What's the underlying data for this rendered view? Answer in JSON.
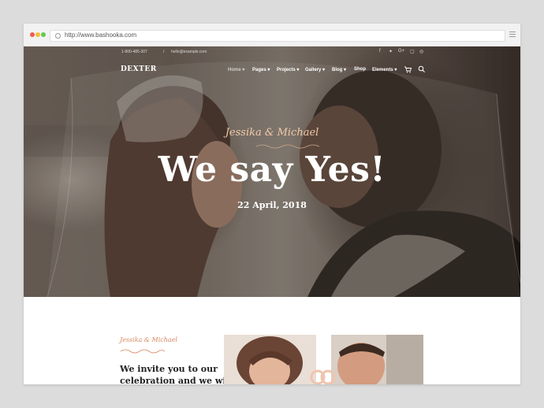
{
  "browser": {
    "url": "http://www.bashooka.com"
  },
  "topbar": {
    "phone": "1-800-485-307",
    "separator": "/",
    "email": "hello@example.com",
    "social_icons": [
      "facebook-icon",
      "twitter-icon",
      "google-plus-icon",
      "instagram-icon",
      "dribbble-icon"
    ]
  },
  "header": {
    "logo": "DEXTER",
    "nav": [
      {
        "label": "Home",
        "dropdown": true
      },
      {
        "label": "Pages",
        "dropdown": true
      },
      {
        "label": "Projects",
        "dropdown": true
      },
      {
        "label": "Gallery",
        "dropdown": true
      },
      {
        "label": "Blog",
        "dropdown": true
      },
      {
        "label": "Shop",
        "dropdown": false
      },
      {
        "label": "Elements",
        "dropdown": true
      }
    ],
    "caret": "▾"
  },
  "hero": {
    "couple": "Jessika & Michael",
    "title": "We say Yes!",
    "date": "22 April, 2018"
  },
  "content": {
    "couple": "Jessika & Michael",
    "invite_line1": "We invite you to our",
    "invite_line2": "celebration and we will"
  },
  "colors": {
    "accent": "#d6875f",
    "script_hero": "#f3c9a8"
  }
}
